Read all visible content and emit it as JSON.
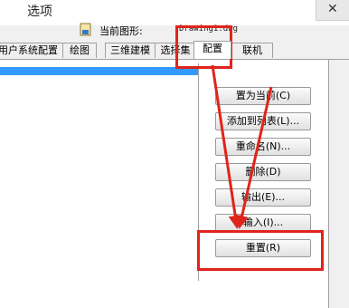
{
  "window": {
    "title": "选项",
    "close_glyph": "✕"
  },
  "drawing": {
    "label": "当前图形:",
    "file": "Drawing1.dwg",
    "icon": "drawing-file-icon"
  },
  "tabs": [
    {
      "label": "用户系统配置"
    },
    {
      "label": "绘图"
    },
    {
      "label": "三维建模"
    },
    {
      "label": "选择集"
    },
    {
      "label": "配置",
      "active": true
    },
    {
      "label": "联机"
    }
  ],
  "buttons": {
    "set_current": "置为当前(C)",
    "add_to_list": "添加到列表(L)...",
    "rename": "重命名(N)...",
    "delete": "删除(D)",
    "export": "输出(E)...",
    "import": "输入(I)...",
    "reset": "重置(R)"
  },
  "colors": {
    "highlight": "#e0241b",
    "selection": "#3399ff"
  }
}
